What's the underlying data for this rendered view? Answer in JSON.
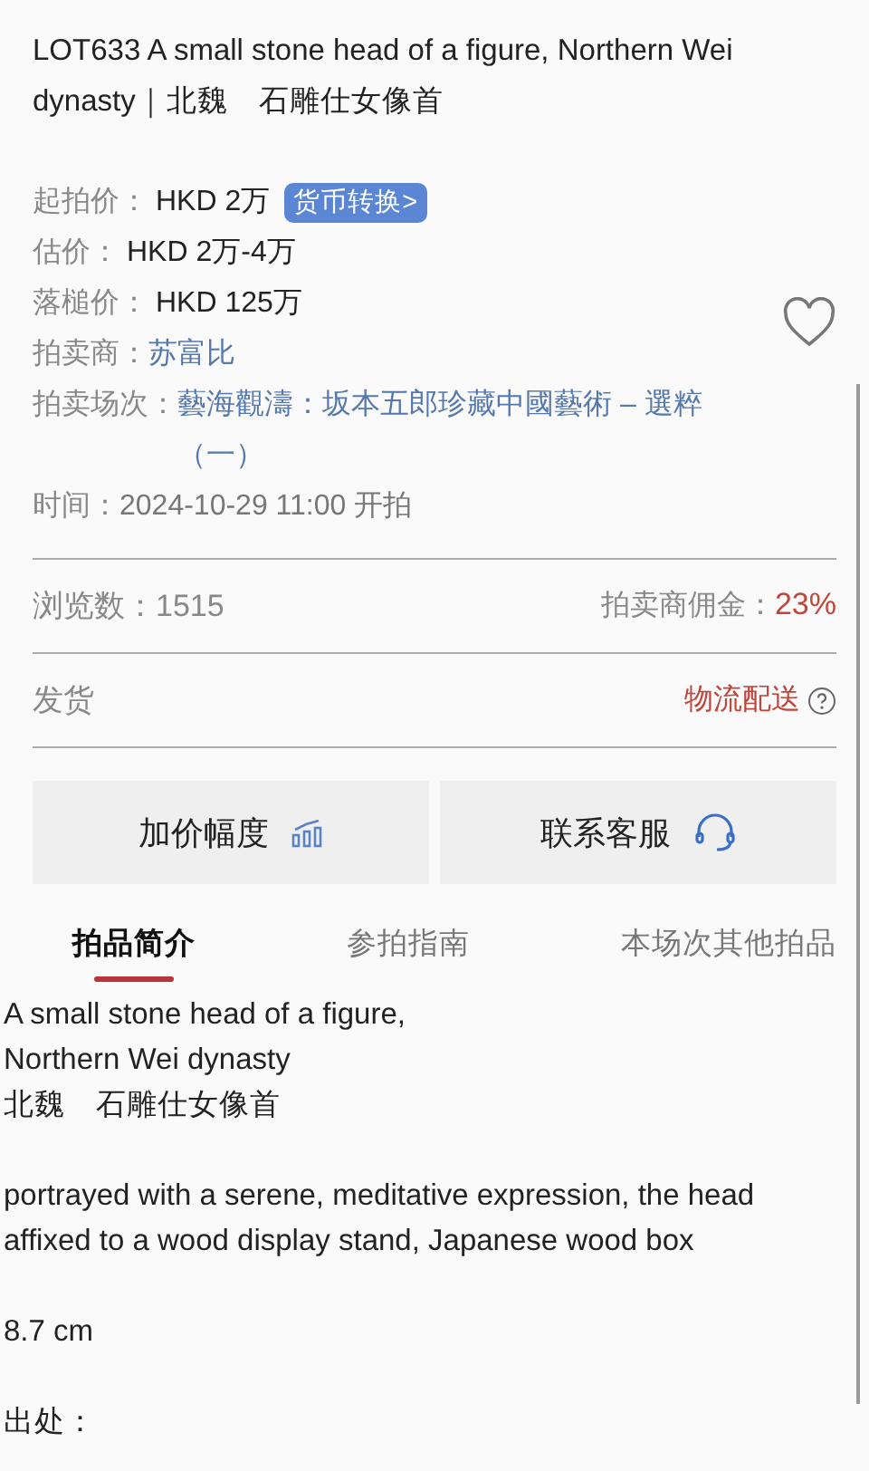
{
  "title": "LOT633 A small stone head of a figure, Northern Wei dynasty｜北魏　石雕仕女像首",
  "favorited": false,
  "info": [
    {
      "label": "起拍价：",
      "value": "HKD 2万",
      "kind": "plain",
      "action": "货币转换>"
    },
    {
      "label": "估价：",
      "value": "HKD 2万-4万",
      "kind": "plain"
    },
    {
      "label": "落槌价：",
      "value": "HKD 125万",
      "kind": "plain"
    },
    {
      "label": "拍卖商：",
      "value": "苏富比",
      "kind": "link"
    },
    {
      "label": "拍卖场次：",
      "value": "藝海觀濤：坂本五郎珍藏中國藝術 – 選粹（一）",
      "kind": "link"
    },
    {
      "label": "时间：",
      "value": "2024-10-29 11:00 开拍",
      "kind": "muted"
    }
  ],
  "stats": {
    "views_label": "浏览数：",
    "views": "1515",
    "commission_label": "拍卖商佣金：",
    "commission": "23%"
  },
  "shipping": {
    "label": "发货",
    "value": "物流配送"
  },
  "buttons": [
    {
      "label": "加价幅度",
      "kind": "chart"
    },
    {
      "label": "联系客服",
      "kind": "headset"
    }
  ],
  "tabs": [
    {
      "label": "拍品简介",
      "selected": true
    },
    {
      "label": "参拍指南",
      "selected": false
    },
    {
      "label": "本场次其他拍品",
      "selected": false
    }
  ],
  "description": [
    "A small stone head of a figure,\nNorthern Wei dynasty\n北魏　石雕仕女像首",
    "portrayed with a serene, meditative expression, the head\naffixed to a wood display stand, Japanese wood box",
    "8.7 cm",
    "出处："
  ]
}
